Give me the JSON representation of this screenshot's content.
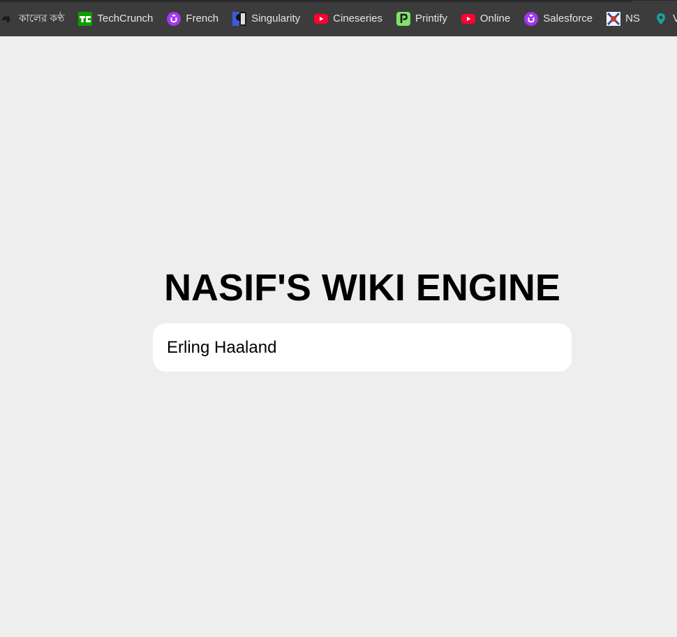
{
  "bookmarks": [
    {
      "label": "কালের কণ্ঠ",
      "icon": "kaler-kantho-icon"
    },
    {
      "label": "TechCrunch",
      "icon": "techcrunch-icon"
    },
    {
      "label": "French",
      "icon": "udemy-icon"
    },
    {
      "label": "Singularity",
      "icon": "singularity-icon"
    },
    {
      "label": "Cineseries",
      "icon": "youtube-icon"
    },
    {
      "label": "Printify",
      "icon": "printify-icon"
    },
    {
      "label": "Online",
      "icon": "youtube-icon"
    },
    {
      "label": "Salesforce",
      "icon": "udemy-icon"
    },
    {
      "label": "NS",
      "icon": "ns-icon"
    },
    {
      "label": "V",
      "icon": "map-pin-icon"
    }
  ],
  "colors": {
    "bookmarks_bar": "#3c3c3c",
    "page_background": "#eeeeee",
    "techcrunch": "#0a9e01",
    "udemy": "#a435f0",
    "youtube": "#ff0033",
    "printify": "#7ee36a",
    "map_pin": "#16a39a"
  },
  "main": {
    "title": "NASIF'S WIKI ENGINE",
    "search": {
      "value": "Erling Haaland",
      "placeholder": ""
    }
  }
}
